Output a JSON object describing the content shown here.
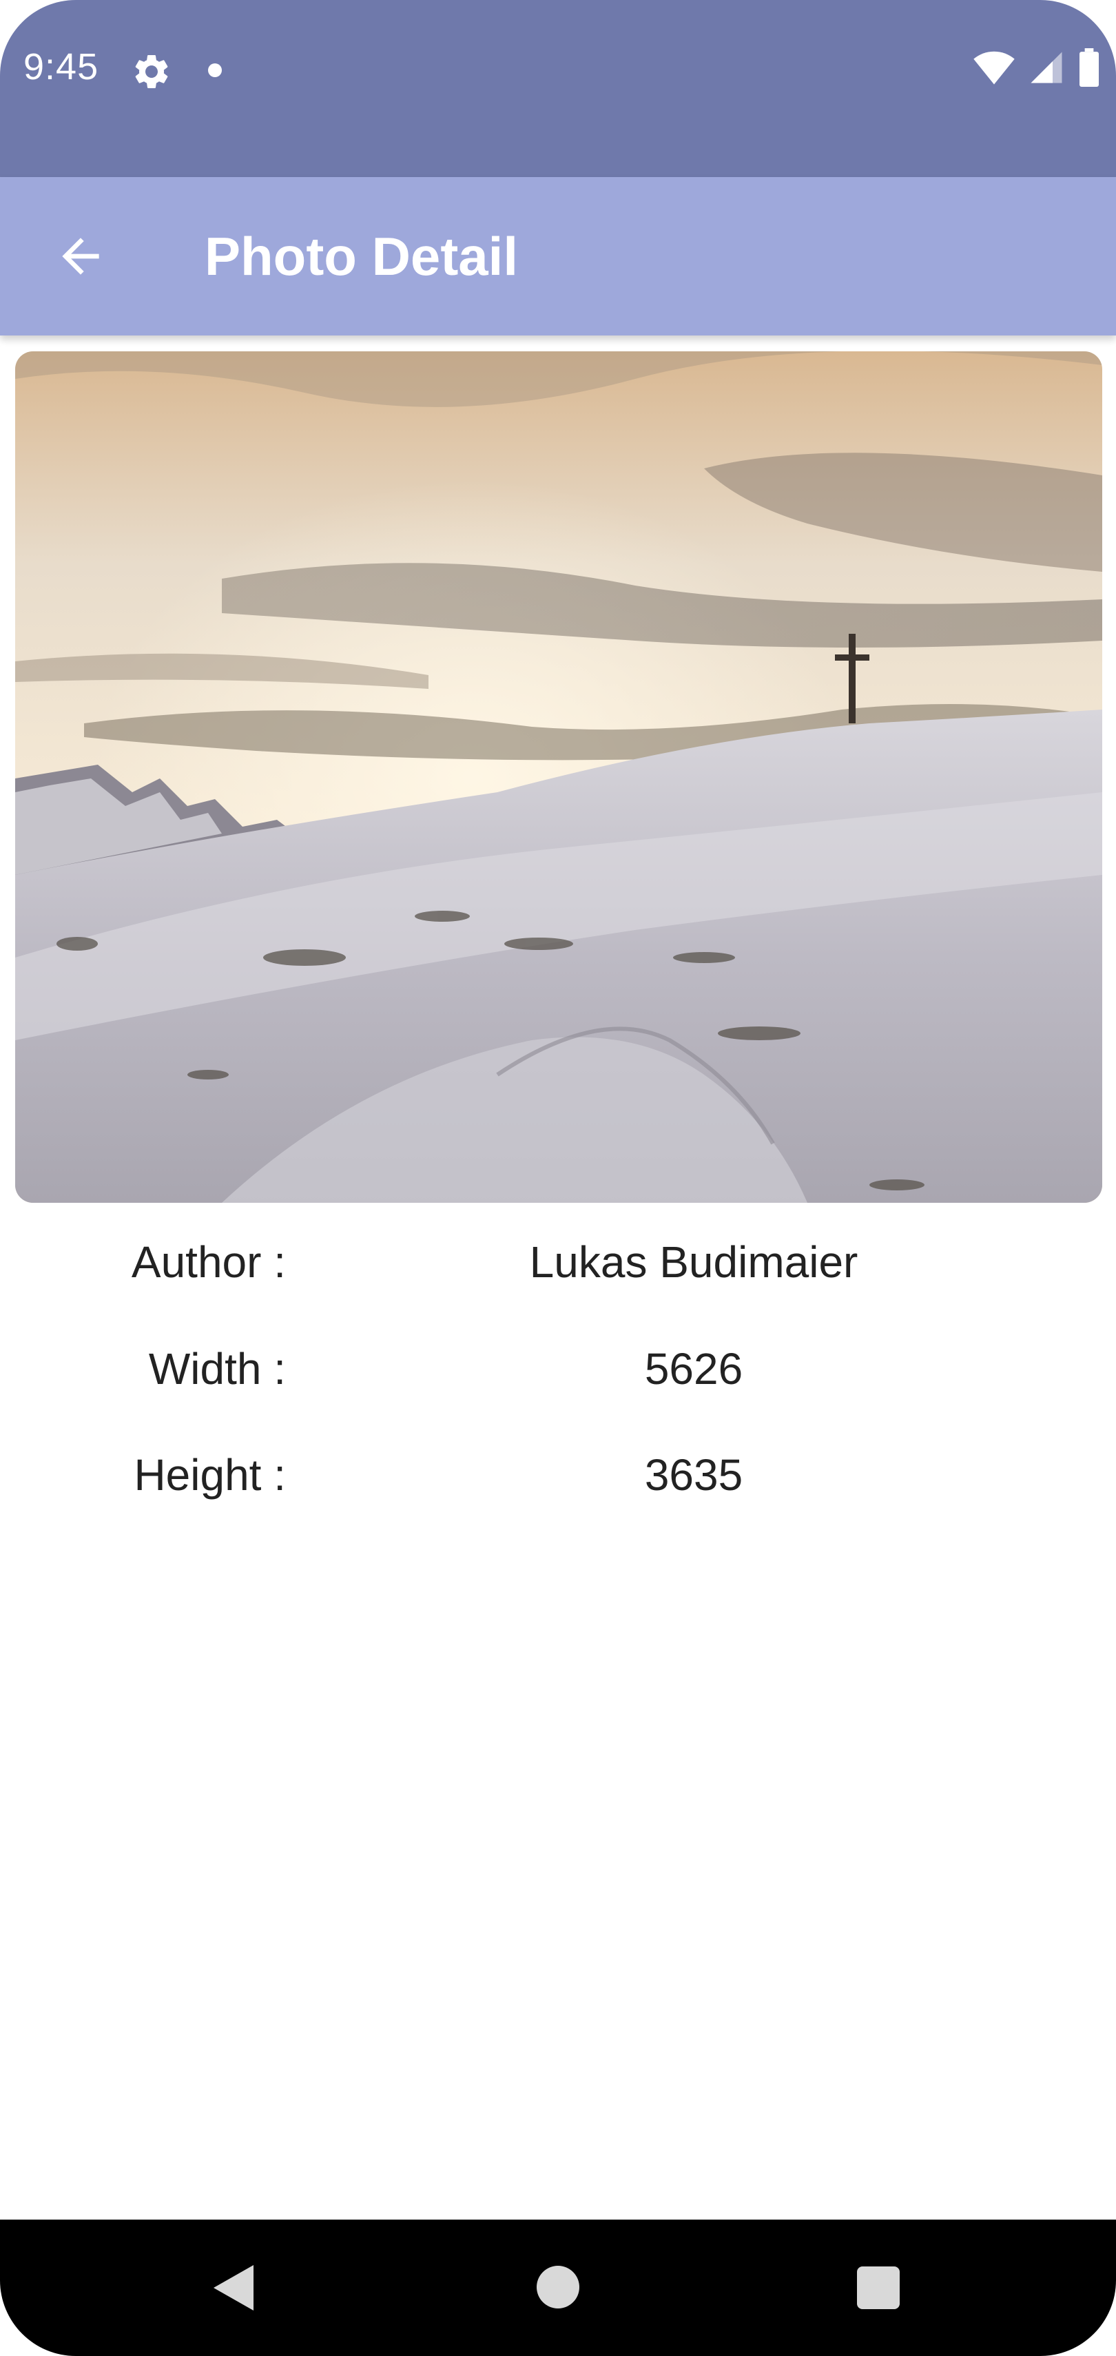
{
  "status_bar": {
    "time": "9:45",
    "icons": [
      "gear-icon",
      "notification-dot-icon",
      "wifi-icon",
      "cell-signal-icon",
      "battery-icon"
    ]
  },
  "app_bar": {
    "title": "Photo Detail",
    "back_icon": "arrow-back-icon"
  },
  "photo": {
    "description_icon": "photo-image"
  },
  "details": [
    {
      "label": "Author :",
      "value": "Lukas Budimaier"
    },
    {
      "label": "Width :",
      "value": "5626"
    },
    {
      "label": "Height :",
      "value": "3635"
    }
  ],
  "nav_bar": {
    "icons": [
      "nav-back-icon",
      "nav-home-icon",
      "nav-recents-icon"
    ]
  },
  "colors": {
    "status_bar": "#6f79ab",
    "app_bar": "#9ea8db",
    "text": "#222222",
    "nav_bar": "#000000"
  }
}
